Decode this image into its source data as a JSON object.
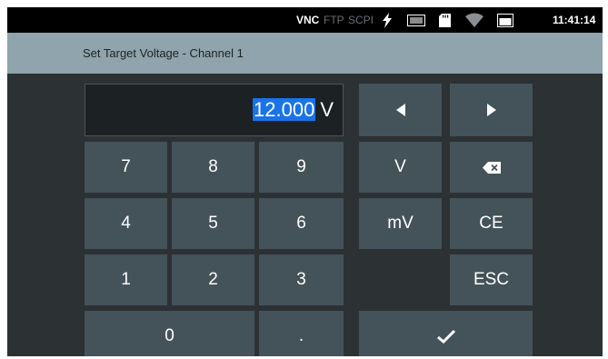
{
  "status_bar": {
    "vnc": "VNC",
    "ftp": "FTP",
    "scpi": "SCPI",
    "time": "11:41:14",
    "icons": [
      "lightning-icon",
      "usb-storage-icon",
      "sd-card-icon",
      "wifi-icon",
      "battery-icon"
    ],
    "active_color": "#ffffff",
    "inactive_color": "#6a6f73"
  },
  "dialog": {
    "title": "Set Target Voltage - Channel 1"
  },
  "display": {
    "value": "12.000",
    "unit": "V",
    "selection_color": "#1a73e8"
  },
  "keys": {
    "k7": "7",
    "k8": "8",
    "k9": "9",
    "k4": "4",
    "k5": "5",
    "k6": "6",
    "k1": "1",
    "k2": "2",
    "k3": "3",
    "k0": "0",
    "dot": ".",
    "unit_v": "V",
    "unit_mv": "mV",
    "ce": "CE",
    "esc": "ESC",
    "left": "left-arrow-icon",
    "right": "right-arrow-icon",
    "backspace": "backspace-icon",
    "enter": "checkmark-icon"
  },
  "colors": {
    "background": "#2c3134",
    "titlebar": "#8fa4ac",
    "key": "#44525a",
    "key_dark": "#374247"
  }
}
